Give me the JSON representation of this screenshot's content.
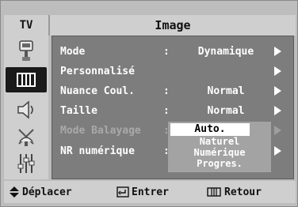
{
  "header": {
    "source_label": "TV",
    "title": "Image"
  },
  "sidebar": {
    "items": [
      {
        "icon": "input-icon",
        "active": false
      },
      {
        "icon": "picture-icon",
        "active": true
      },
      {
        "icon": "sound-icon",
        "active": false
      },
      {
        "icon": "channel-icon",
        "active": false
      },
      {
        "icon": "setup-icon",
        "active": false
      }
    ]
  },
  "menu": {
    "rows": [
      {
        "label": "Mode",
        "colon": ":",
        "value": "Dynamique"
      },
      {
        "label": "Personnalisé",
        "colon": "",
        "value": ""
      },
      {
        "label": "Nuance Coul.",
        "colon": ":",
        "value": "Normal"
      },
      {
        "label": "Taille",
        "colon": ":",
        "value": "Normal"
      },
      {
        "label": "Mode Balayage",
        "colon": ":",
        "value": ""
      },
      {
        "label": "NR numérique",
        "colon": ":",
        "value": ""
      }
    ],
    "dropdown": {
      "options": [
        "Auto.",
        "Naturel",
        "Numérique",
        "Progres."
      ],
      "selected": "Auto."
    }
  },
  "footer": {
    "move_label": "Déplacer",
    "enter_label": "Entrer",
    "return_label": "Retour"
  },
  "colors": {
    "panel": "#7d7d7d",
    "frame": "#bdbdbd",
    "highlight": "#ffffff"
  }
}
